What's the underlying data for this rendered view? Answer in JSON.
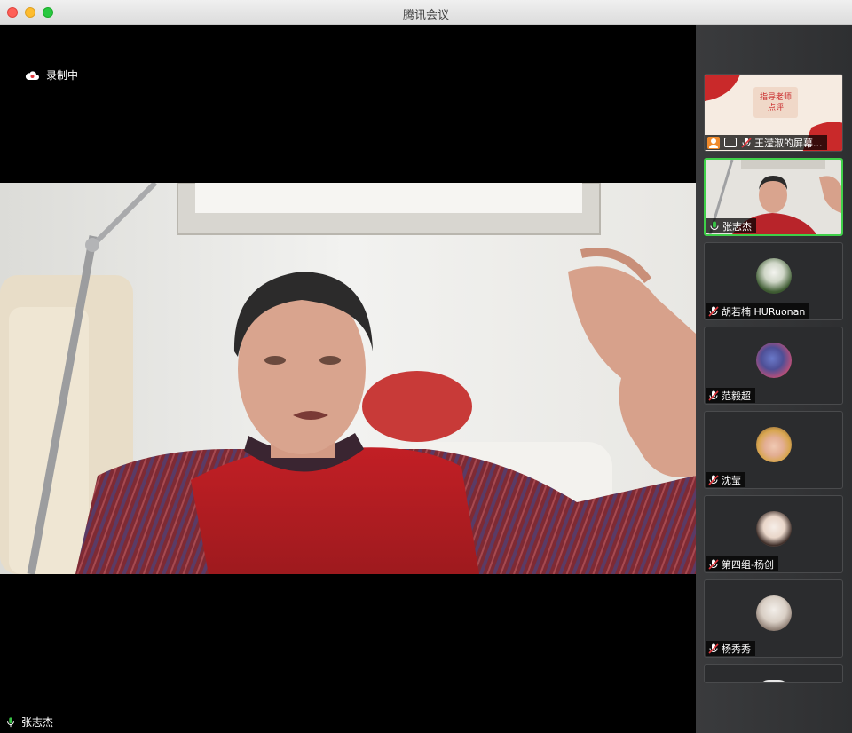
{
  "window": {
    "title": "腾讯会议"
  },
  "recording": {
    "label": "录制中"
  },
  "main_video": {
    "speaker_name": "张志杰"
  },
  "screen_share_tile": {
    "banner_text_line1": "指导老师",
    "banner_text_line2": "点评",
    "label": "王滢淑的屏幕..."
  },
  "participants": [
    {
      "name": "张志杰",
      "active": true,
      "muted": false
    },
    {
      "name": "胡若楠 HURuonan",
      "active": false,
      "muted": true
    },
    {
      "name": "范毅超",
      "active": false,
      "muted": true
    },
    {
      "name": "沈莹",
      "active": false,
      "muted": true
    },
    {
      "name": "第四组-杨创",
      "active": false,
      "muted": true
    },
    {
      "name": "杨秀秀",
      "active": false,
      "muted": true
    }
  ],
  "colors": {
    "active_border": "#3fd049",
    "mic_muted": "#e0383e",
    "mic_on": "#37c245",
    "recording": "#e0383e"
  }
}
